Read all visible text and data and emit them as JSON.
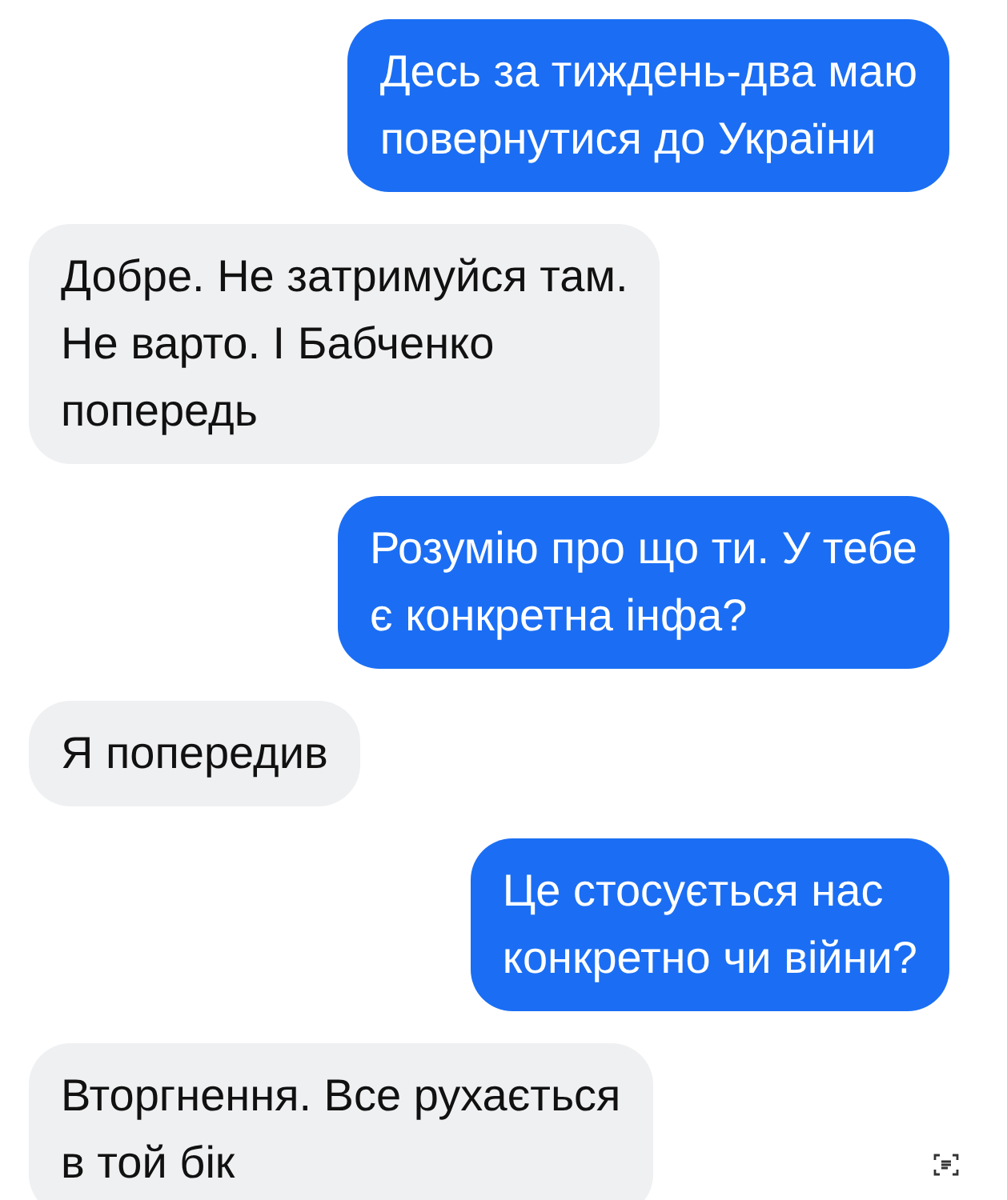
{
  "messages": [
    {
      "kind": "sent",
      "text": "Десь за тиждень-два маю\nповернутися до України"
    },
    {
      "kind": "received",
      "text": "Добре. Не затримуйся там.\nНе варто. І Бабченко\nпопередь"
    },
    {
      "kind": "sent",
      "text": "Розумію про що ти. У тебе\nє конкретна інфа?"
    },
    {
      "kind": "received",
      "text": "Я попередив"
    },
    {
      "kind": "sent",
      "text": "Це стосується нас\nконкретно чи війни?"
    },
    {
      "kind": "received",
      "text": "Вторгнення. Все рухається\nв той бік"
    }
  ]
}
